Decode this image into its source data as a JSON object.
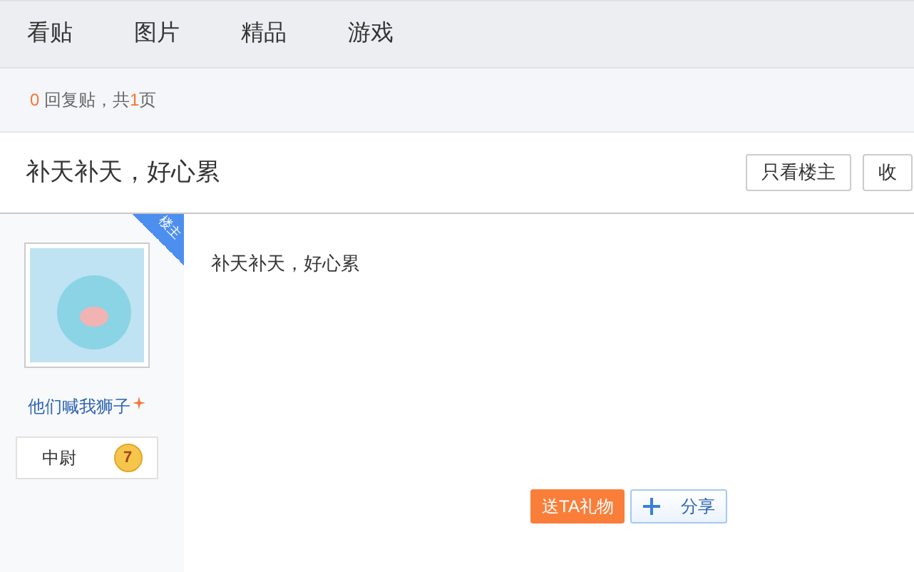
{
  "nav": {
    "tabs": [
      {
        "label": "看贴"
      },
      {
        "label": "图片"
      },
      {
        "label": "精品"
      },
      {
        "label": "游戏"
      }
    ]
  },
  "reply_bar": {
    "reply_count": "0",
    "reply_label": "回复贴，共",
    "page_count": "1",
    "page_label": "页"
  },
  "thread": {
    "title": "补天补天，好心累",
    "buttons": [
      "只看楼主",
      "收"
    ]
  },
  "post": {
    "author": {
      "name": "他们喊我狮子",
      "badge": "楼主",
      "rank": "中尉",
      "rank_level": "7"
    },
    "content": "补天补天，好心累",
    "actions": [
      {
        "kind": "gift",
        "label": "送TA礼物"
      },
      {
        "kind": "share",
        "label": "分享"
      }
    ]
  }
}
